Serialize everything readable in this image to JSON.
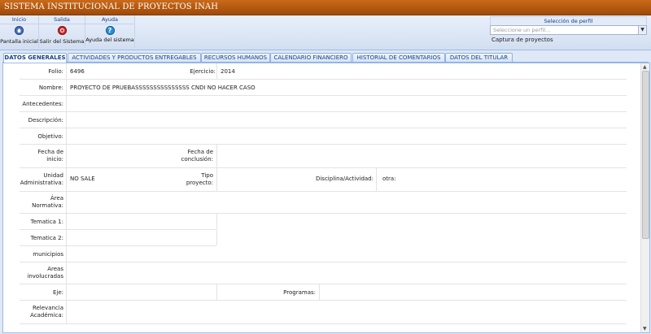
{
  "app": {
    "title": "SISTEMA INSTITUCIONAL DE PROYECTOS INAH"
  },
  "toolbar": {
    "groups": [
      {
        "header": "Inicio",
        "button": "Pantalla inicial",
        "icon": "home-icon"
      },
      {
        "header": "Salida",
        "button": "Salir del Sistema",
        "icon": "power-icon"
      },
      {
        "header": "Ayuda",
        "button": "Ayuda del sistema",
        "icon": "help-icon"
      }
    ]
  },
  "profile": {
    "header": "Selección de perfil",
    "placeholder": "Seleccione un perfil...",
    "current": "Captura de proyectos"
  },
  "tabs": [
    {
      "label": "DATOS GENERALES",
      "active": true
    },
    {
      "label": "ACTIVIDADES Y PRODUCTOS ENTREGABLES"
    },
    {
      "label": "RECURSOS HUMANOS"
    },
    {
      "label": "CALENDARIO FINANCIERO"
    },
    {
      "label": "HISTORIAL DE COMENTARIOS"
    },
    {
      "label": "DATOS DEL TITULAR"
    }
  ],
  "form": {
    "folio_label": "Folio:",
    "folio": "6496",
    "ejercicio_label": "Ejercicio:",
    "ejercicio": "2014",
    "nombre_label": "Nombre:",
    "nombre": "PROYECTO DE PRUEBASSSSSSSSSSSSSSS CNDI NO HACER CASO",
    "antecedentes_label": "Antecedentes:",
    "descripcion_label": "Descripción:",
    "objetivo_label": "Objetivo:",
    "fecha_inicio_l1": "Fecha de",
    "fecha_inicio_l2": "inicio:",
    "fecha_concl_l1": "Fecha de",
    "fecha_concl_l2": "conclusión:",
    "unidad_l1": "Unidad",
    "unidad_l2": "Administrativa:",
    "unidad": "NO SALE",
    "tipo_l1": "Tipo",
    "tipo_l2": "proyecto:",
    "disciplina_label": "Disciplina/Actividad:",
    "otra_label": "otra:",
    "area_l1": "Área",
    "area_l2": "Normativa:",
    "tematica1_label": "Tematica 1:",
    "tematica2_label": "Tematica 2:",
    "municipios_label": "municipios",
    "areas_l1": "Areas",
    "areas_l2": "involucradas",
    "eje_label": "Eje:",
    "programas_label": "Programas:",
    "relevancia_l1": "Relevancia",
    "relevancia_l2": "Académica:"
  }
}
